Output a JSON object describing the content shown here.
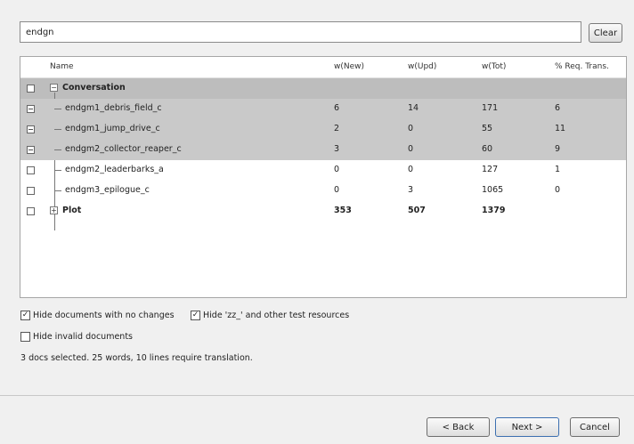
{
  "search": {
    "value": "endgn",
    "clear_label": "Clear"
  },
  "columns": {
    "name": "Name",
    "new": "w(New)",
    "upd": "w(Upd)",
    "tot": "w(Tot)",
    "req": "% Req. Trans."
  },
  "groups": {
    "conversation": {
      "label": "Conversation",
      "expander": "−"
    },
    "plot": {
      "label": "Plot",
      "expander": "+",
      "new": "353",
      "upd": "507",
      "tot": "1379"
    }
  },
  "rows": [
    {
      "name": "endgm1_debris_field_c",
      "new": "6",
      "upd": "14",
      "tot": "171",
      "req": "6"
    },
    {
      "name": "endgm1_jump_drive_c",
      "new": "2",
      "upd": "0",
      "tot": "55",
      "req": "11"
    },
    {
      "name": "endgm2_collector_reaper_c",
      "new": "3",
      "upd": "0",
      "tot": "60",
      "req": "9"
    },
    {
      "name": "endgm2_leaderbarks_a",
      "new": "0",
      "upd": "0",
      "tot": "127",
      "req": "1"
    },
    {
      "name": "endgm3_epilogue_c",
      "new": "0",
      "upd": "3",
      "tot": "1065",
      "req": "0"
    }
  ],
  "options": {
    "hide_no_changes": "Hide documents with no changes",
    "hide_test": "Hide 'zz_' and other test resources",
    "hide_invalid": "Hide invalid documents"
  },
  "status": "3 docs selected.  25 words, 10 lines require translation.",
  "buttons": {
    "back": "< Back",
    "next": "Next >",
    "cancel": "Cancel"
  }
}
